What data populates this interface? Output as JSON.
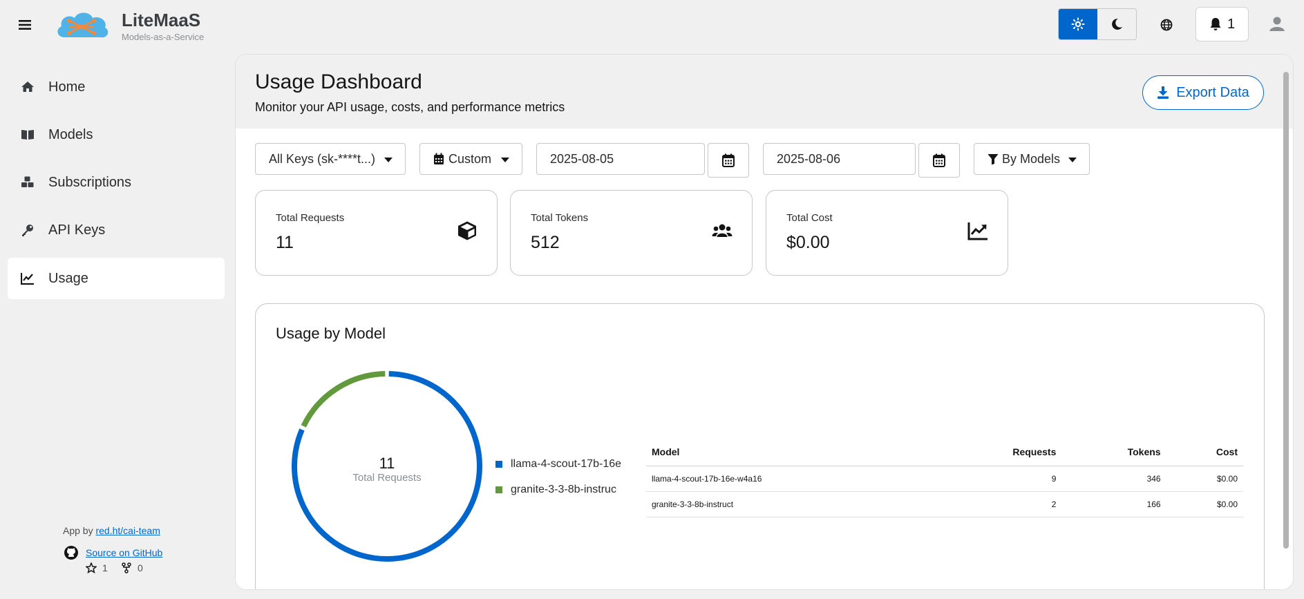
{
  "brand": {
    "name": "LiteMaaS",
    "tagline": "Models-as-a-Service"
  },
  "masthead": {
    "notification_count": "1",
    "theme_active": "light"
  },
  "sidebar": {
    "items": [
      {
        "label": "Home",
        "icon": "home-icon"
      },
      {
        "label": "Models",
        "icon": "book-icon"
      },
      {
        "label": "Subscriptions",
        "icon": "cubes-icon"
      },
      {
        "label": "API Keys",
        "icon": "key-icon"
      },
      {
        "label": "Usage",
        "icon": "chart-line-icon",
        "active": true
      }
    ],
    "footer": {
      "credit_prefix": "App by",
      "credit_link": "red.ht/cai-team",
      "source_link": "Source on GitHub",
      "stars": "1",
      "forks": "0"
    }
  },
  "page": {
    "title": "Usage Dashboard",
    "description": "Monitor your API usage, costs, and performance metrics",
    "export_label": "Export Data"
  },
  "filters": {
    "keys_select": "All Keys (sk-****t...)",
    "range_select": "Custom",
    "start_date": "2025-08-05",
    "end_date": "2025-08-06",
    "group_by": "By Models"
  },
  "stats": [
    {
      "label": "Total Requests",
      "value": "11",
      "icon": "cube-icon"
    },
    {
      "label": "Total Tokens",
      "value": "512",
      "icon": "users-icon"
    },
    {
      "label": "Total Cost",
      "value": "$0.00",
      "icon": "trend-chart-icon"
    }
  ],
  "usage_by_model": {
    "title": "Usage by Model",
    "center_value": "11",
    "center_label": "Total Requests",
    "table_headers": [
      "Model",
      "Requests",
      "Tokens",
      "Cost"
    ],
    "rows": [
      {
        "model": "llama-4-scout-17b-16e-w4a16",
        "requests": "9",
        "tokens": "346",
        "cost": "$0.00"
      },
      {
        "model": "granite-3-3-8b-instruct",
        "requests": "2",
        "tokens": "166",
        "cost": "$0.00"
      }
    ]
  },
  "chart_data": {
    "type": "pie",
    "categories": [
      "llama-4-scout-17b-16e-w4a16",
      "granite-3-3-8b-instruct"
    ],
    "values": [
      9,
      2
    ],
    "legend_labels": [
      "llama-4-scout-17b-16e",
      "granite-3-3-8b-instruc"
    ],
    "colors": [
      "#0066cc",
      "#63993d"
    ],
    "title": "Usage by Model",
    "legend": "right"
  }
}
